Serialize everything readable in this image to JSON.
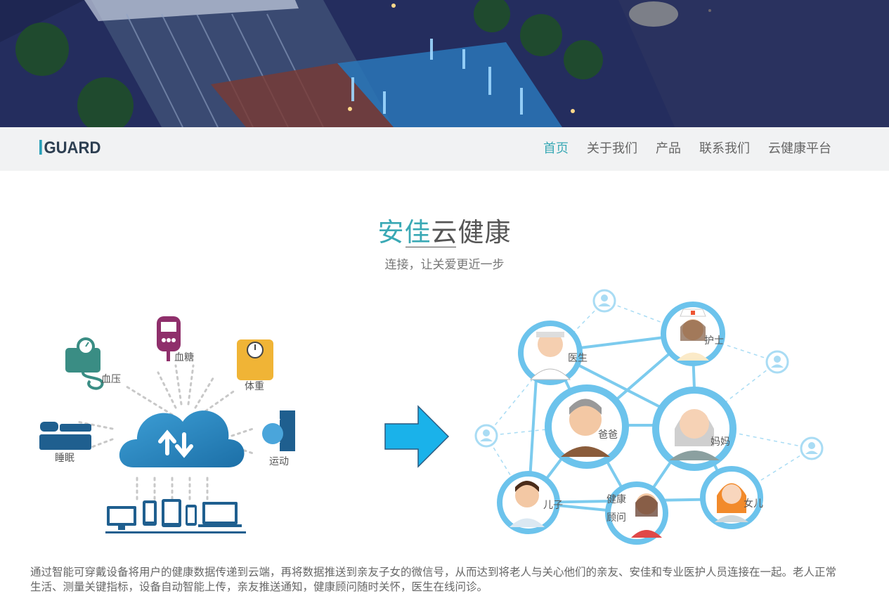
{
  "brand": {
    "logo_text": "GUARD",
    "accent_color": "#3aa9b5"
  },
  "nav": {
    "items": [
      {
        "label": "首页",
        "active": true
      },
      {
        "label": "关于我们",
        "active": false
      },
      {
        "label": "产品",
        "active": false
      },
      {
        "label": "联系我们",
        "active": false
      },
      {
        "label": "云健康平台",
        "active": false
      }
    ]
  },
  "hero": {
    "title_highlight": "安佳",
    "title_rest": "云健康",
    "subtitle": "连接，让关爱更近一步"
  },
  "devices": {
    "blood_pressure": "血压",
    "blood_sugar": "血糖",
    "weight": "体重",
    "sleep": "睡眠",
    "exercise": "运动"
  },
  "network": {
    "doctor": "医生",
    "nurse": "护士",
    "dad": "爸爸",
    "mom": "妈妈",
    "son": "儿子",
    "consultant_line1": "健康",
    "consultant_line2": "顾问",
    "daughter": "女儿"
  },
  "description": "通过智能可穿戴设备将用户的健康数据传递到云端，再将数据推送到亲友子女的微信号，从而达到将老人与关心他们的亲友、安佳和专业医护人员连接在一起。老人正常生活、测量关键指标，设备自动智能上传，亲友推送通知，健康顾问随时关怀，医生在线问诊。"
}
